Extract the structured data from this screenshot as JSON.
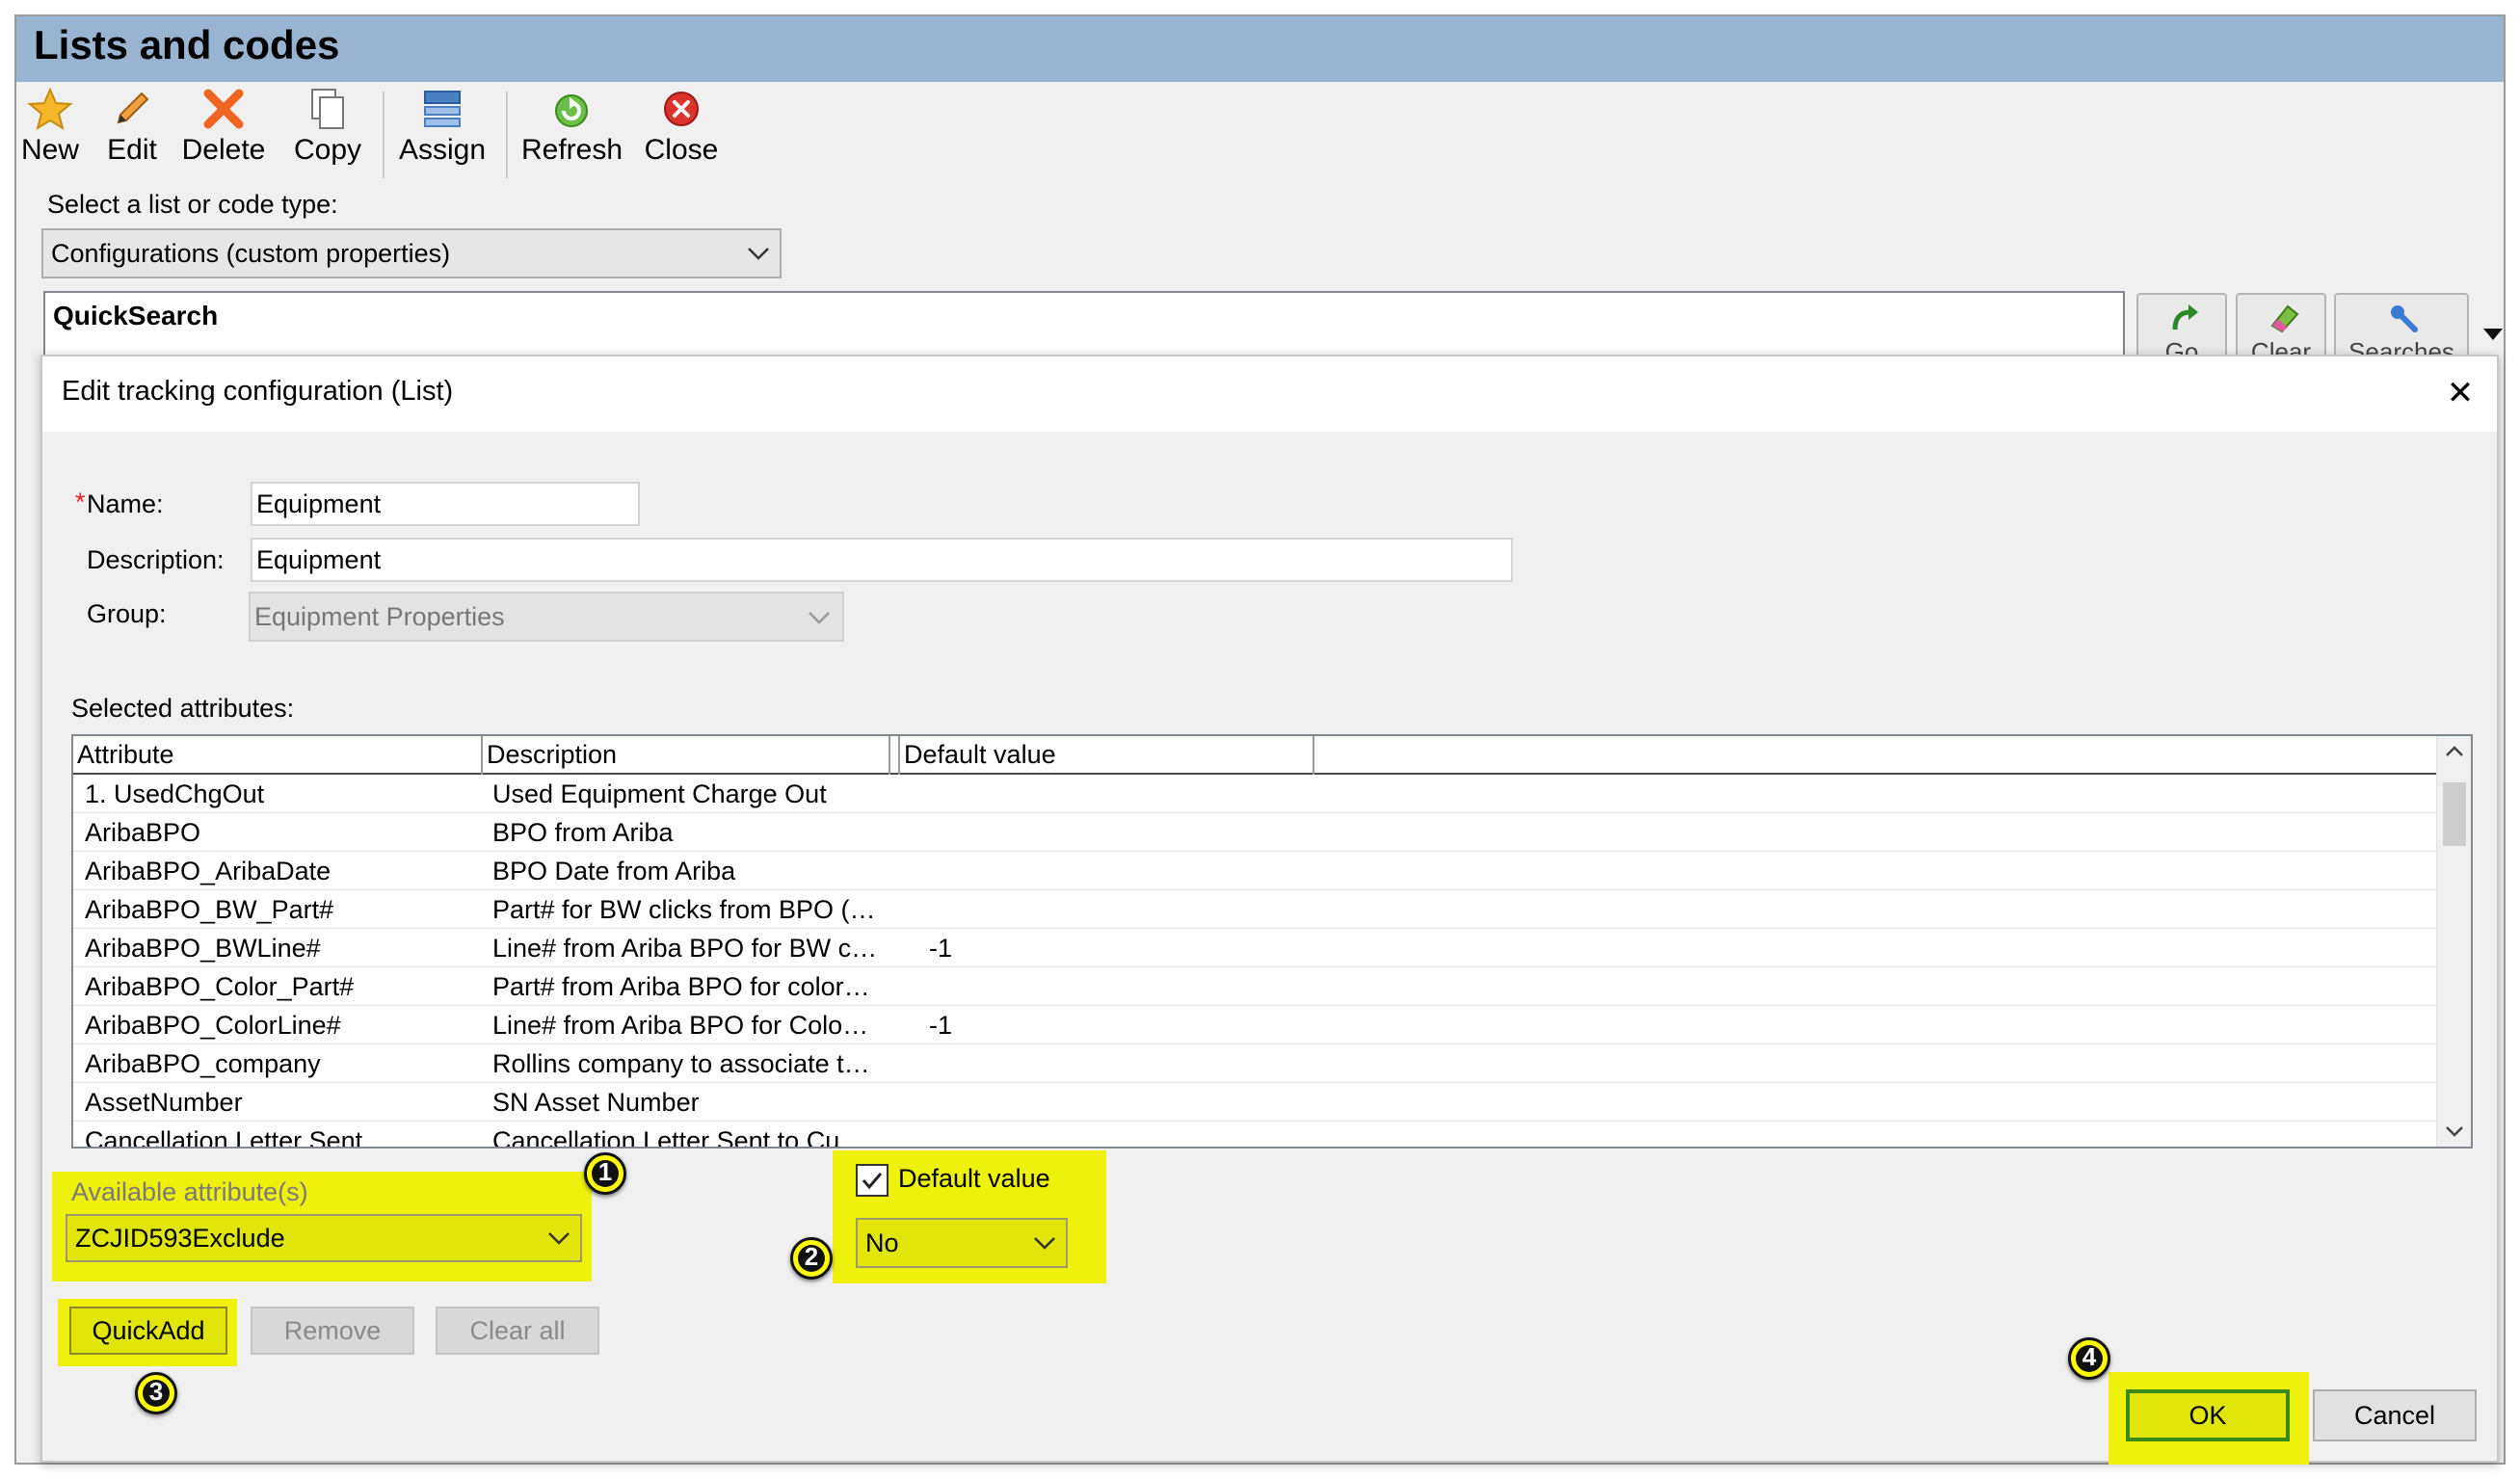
{
  "window": {
    "title": "Lists and codes"
  },
  "toolbar": {
    "new": "New",
    "edit": "Edit",
    "delete": "Delete",
    "copy": "Copy",
    "assign": "Assign",
    "refresh": "Refresh",
    "close": "Close"
  },
  "list_type": {
    "label": "Select a list or code type:",
    "value": "Configurations (custom properties)"
  },
  "quicksearch": {
    "title": "QuickSearch",
    "go": "Go",
    "clear": "Clear",
    "searches": "Searches"
  },
  "dialog": {
    "title": "Edit tracking configuration (List)",
    "close": "✕",
    "name_label": "Name:",
    "name_required_mark": "*",
    "name_value": "Equipment",
    "description_label": "Description:",
    "description_value": "Equipment",
    "group_label": "Group:",
    "group_value": "Equipment Properties",
    "selected_attributes_label": "Selected attributes:",
    "columns": [
      "Attribute",
      "Description",
      "Default value"
    ],
    "rows": [
      {
        "attribute": "1. UsedChgOut",
        "description": "Used Equipment Charge Out",
        "default": ""
      },
      {
        "attribute": "AribaBPO",
        "description": "BPO from Ariba",
        "default": ""
      },
      {
        "attribute": "AribaBPO_AribaDate",
        "description": "BPO Date from Ariba",
        "default": ""
      },
      {
        "attribute": "AribaBPO_BW_Part#",
        "description": "Part# for BW clicks from BPO (…",
        "default": ""
      },
      {
        "attribute": "AribaBPO_BWLine#",
        "description": "Line# from Ariba BPO for BW c…",
        "default": "-1"
      },
      {
        "attribute": "AribaBPO_Color_Part#",
        "description": "Part# from Ariba BPO for color…",
        "default": ""
      },
      {
        "attribute": "AribaBPO_ColorLine#",
        "description": "Line# from Ariba BPO for Colo…",
        "default": "-1"
      },
      {
        "attribute": "AribaBPO_company",
        "description": "Rollins company to associate t…",
        "default": ""
      },
      {
        "attribute": "AssetNumber",
        "description": "SN Asset Number",
        "default": ""
      },
      {
        "attribute": "Cancellation Letter Sent",
        "description": "Cancellation Letter Sent to Cu…",
        "default": ""
      }
    ],
    "available_label": "Available attribute(s)",
    "available_value": "ZCJID593Exclude",
    "default_value_label": "Default value",
    "default_value_checked": true,
    "default_value_select": "No",
    "quickadd": "QuickAdd",
    "remove": "Remove",
    "clear_all": "Clear all",
    "ok": "OK",
    "cancel": "Cancel"
  },
  "callouts": [
    "1",
    "2",
    "3",
    "4"
  ],
  "colors": {
    "highlight": "#eef10b",
    "titlebar": "#99b4d1",
    "ok_border": "#3a8a1a"
  }
}
